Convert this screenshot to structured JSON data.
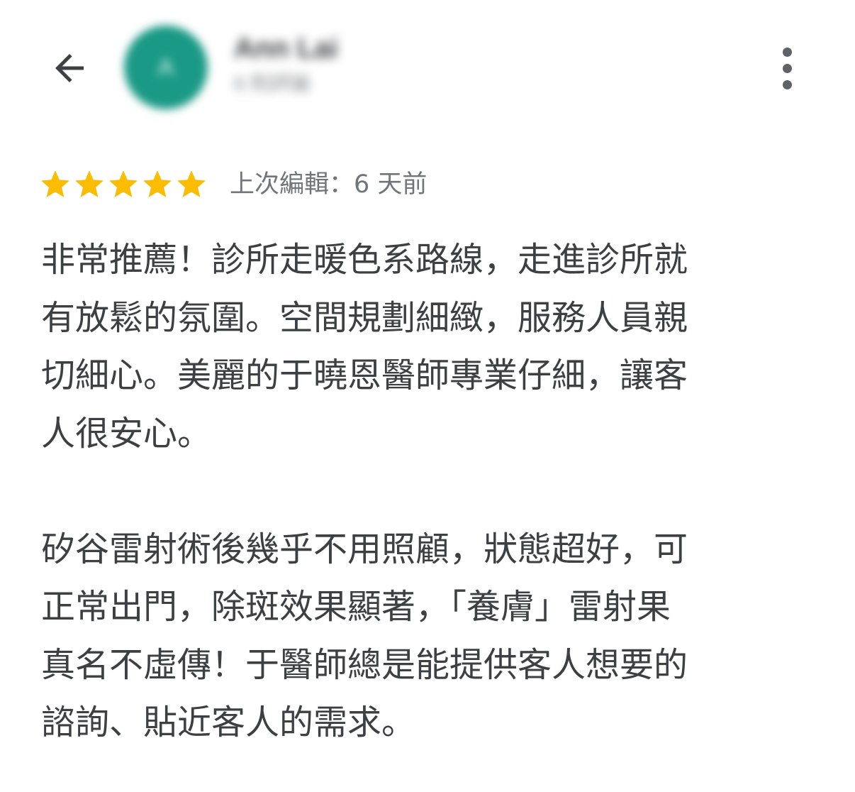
{
  "header": {
    "back_icon": "arrow-back-icon",
    "avatar_initial": "A",
    "avatar_color": "#1a9a86",
    "user_name": "Ann Lai",
    "user_meta": "6 則評論",
    "more_icon": "more-vert-icon"
  },
  "rating": {
    "stars": 5,
    "max_stars": 5,
    "star_color": "#fbbc04",
    "edit_info": "上次編輯：6 天前"
  },
  "review": {
    "paragraphs": [
      [
        "非常推薦！診所走暖色系路線，走進診所就",
        "有放鬆的氛圍。空間規劃細緻，服務人員親",
        "切細心。美麗的于曉恩醫師專業仔細，讓客",
        "人很安心。"
      ],
      [
        "矽谷雷射術後幾乎不用照顧，狀態超好，可",
        "正常出門，除斑效果顯著，「養膚」雷射果",
        "真名不虛傳！于醫師總是能提供客人想要的",
        "諮詢、貼近客人的需求。"
      ]
    ]
  }
}
